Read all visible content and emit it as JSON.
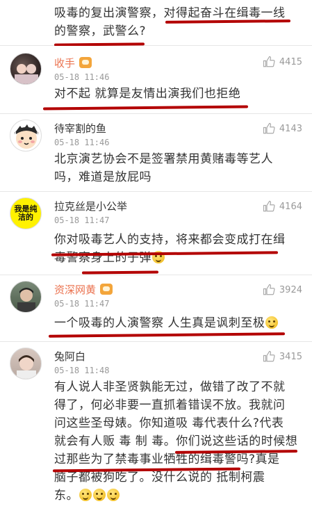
{
  "top_comment": {
    "lines": [
      "吸毒的复出演警察，对得起奋斗在缉毒一线",
      "的警察，武警么?"
    ]
  },
  "comments": [
    {
      "username": "收手",
      "vip": true,
      "time": "05-18 11:46",
      "likes": "4415",
      "lines": [
        "对不起 就算是友情出演我们也拒绝"
      ]
    },
    {
      "username": "待宰割的鱼",
      "vip": false,
      "time": "05-18 11:46",
      "likes": "4143",
      "lines": [
        "北京演艺协会不是签署禁用黄赌毒等艺人",
        "吗，难道是放屁吗"
      ]
    },
    {
      "username": "拉克丝是小公举",
      "vip": false,
      "time": "05-18 11:47",
      "likes": "4164",
      "avatar_text": "我是纯洁的",
      "lines": [
        "你对吸毒艺人的支持，将来都会变成打在缉",
        "毒警察身上的子弹"
      ]
    },
    {
      "username": "资深网黄",
      "vip": true,
      "time": "05-18 11:47",
      "likes": "3924",
      "lines": [
        "一个吸毒的人演警察 人生真是讽刺至极"
      ]
    },
    {
      "username": "兔阿白",
      "vip": false,
      "time": "05-18 11:48",
      "likes": "3415",
      "lines": [
        "有人说人非圣贤孰能无过，做错了改了不就",
        "得了，何必非要一直抓着错误不放。我就问",
        "问这些圣母婊。你知道吸 毒代表什么?代表",
        "就会有人贩 毒 制 毒。你们说这些话的时候想",
        "过那些为了禁毒事业牺牲的缉毒警吗?真是",
        "脑子都被狗吃了。没什么说的 抵制柯震",
        "东。"
      ]
    }
  ],
  "colors": {
    "vip_name": "#eb7350",
    "underline": "#b30000",
    "meta": "#999999"
  },
  "icons": {
    "like": "thumbs-up-icon",
    "vip": "vip-badge-icon",
    "emoji": "smile-emoji-icon"
  }
}
